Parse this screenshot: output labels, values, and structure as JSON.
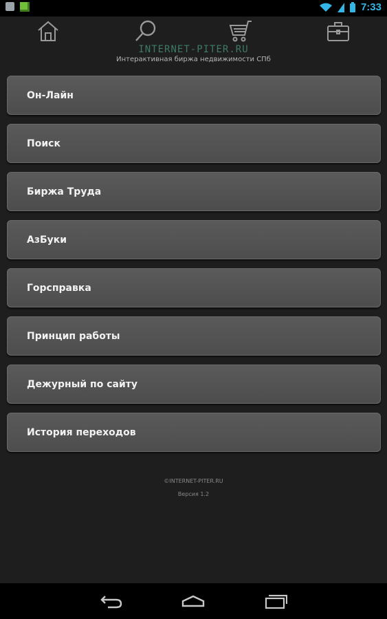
{
  "status_bar": {
    "time": "7:33"
  },
  "top_nav": {
    "items": [
      {
        "name": "home",
        "icon": "home-icon"
      },
      {
        "name": "search",
        "icon": "search-icon"
      },
      {
        "name": "cart",
        "icon": "cart-icon"
      },
      {
        "name": "briefcase",
        "icon": "briefcase-icon"
      }
    ]
  },
  "header": {
    "site_name": "INTERNET-PITER.RU",
    "tagline": "Интерактивная биржа недвижимости СПб"
  },
  "menu": {
    "items": [
      {
        "label": "Он-Лайн"
      },
      {
        "label": "Поиск"
      },
      {
        "label": "Биржа Труда"
      },
      {
        "label": "АзБуки"
      },
      {
        "label": "Горсправка"
      },
      {
        "label": "Принцип работы"
      },
      {
        "label": "Дежурный по сайту"
      },
      {
        "label": "История переходов"
      }
    ]
  },
  "footer": {
    "copyright": "©INTERNET-PITER.RU",
    "version": "Версия 1.2"
  },
  "colors": {
    "accent": "#33b5e5",
    "site_name": "#3e7a66",
    "button_bg": "#555555"
  }
}
